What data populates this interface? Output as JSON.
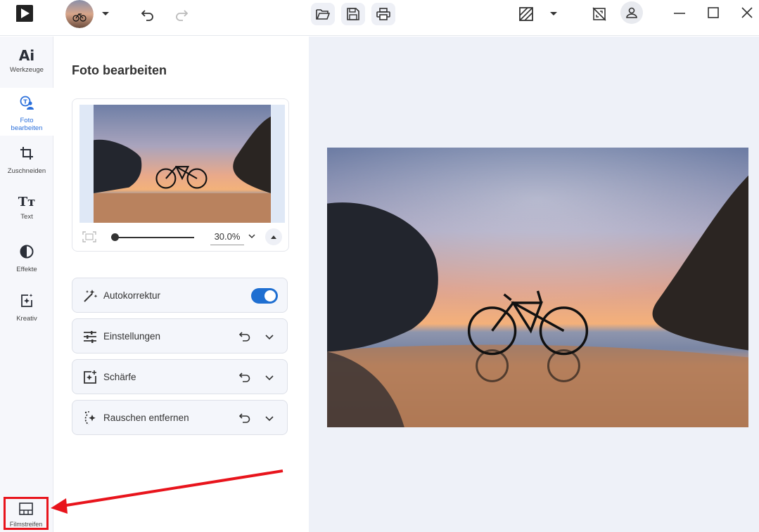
{
  "panel": {
    "title": "Foto bearbeiten",
    "zoom_value": "30.0%",
    "sections": [
      {
        "label": "Autokorrektur",
        "toggle_on": true
      },
      {
        "label": "Einstellungen"
      },
      {
        "label": "Schärfe"
      },
      {
        "label": "Rauschen entfernen"
      }
    ]
  },
  "rail": {
    "items": [
      {
        "glyph": "Ai",
        "label": "Werkzeuge",
        "icon": "ai-tools-icon"
      },
      {
        "label_line1": "Foto",
        "label_line2": "bearbeiten",
        "icon": "photo-edit-icon",
        "active": true
      },
      {
        "label": "Zuschneiden",
        "icon": "crop-icon"
      },
      {
        "glyph": "Tт",
        "label": "Text",
        "icon": "text-icon"
      },
      {
        "label": "Effekte",
        "icon": "effects-icon"
      },
      {
        "label": "Kreativ",
        "icon": "creative-icon"
      }
    ],
    "filmstrip_label": "Filmstreifen"
  },
  "colors": {
    "accent": "#2a6fdb",
    "toggle": "#1f6fd1",
    "highlight": "#e8141c",
    "canvas_bg": "#eef1f8"
  }
}
